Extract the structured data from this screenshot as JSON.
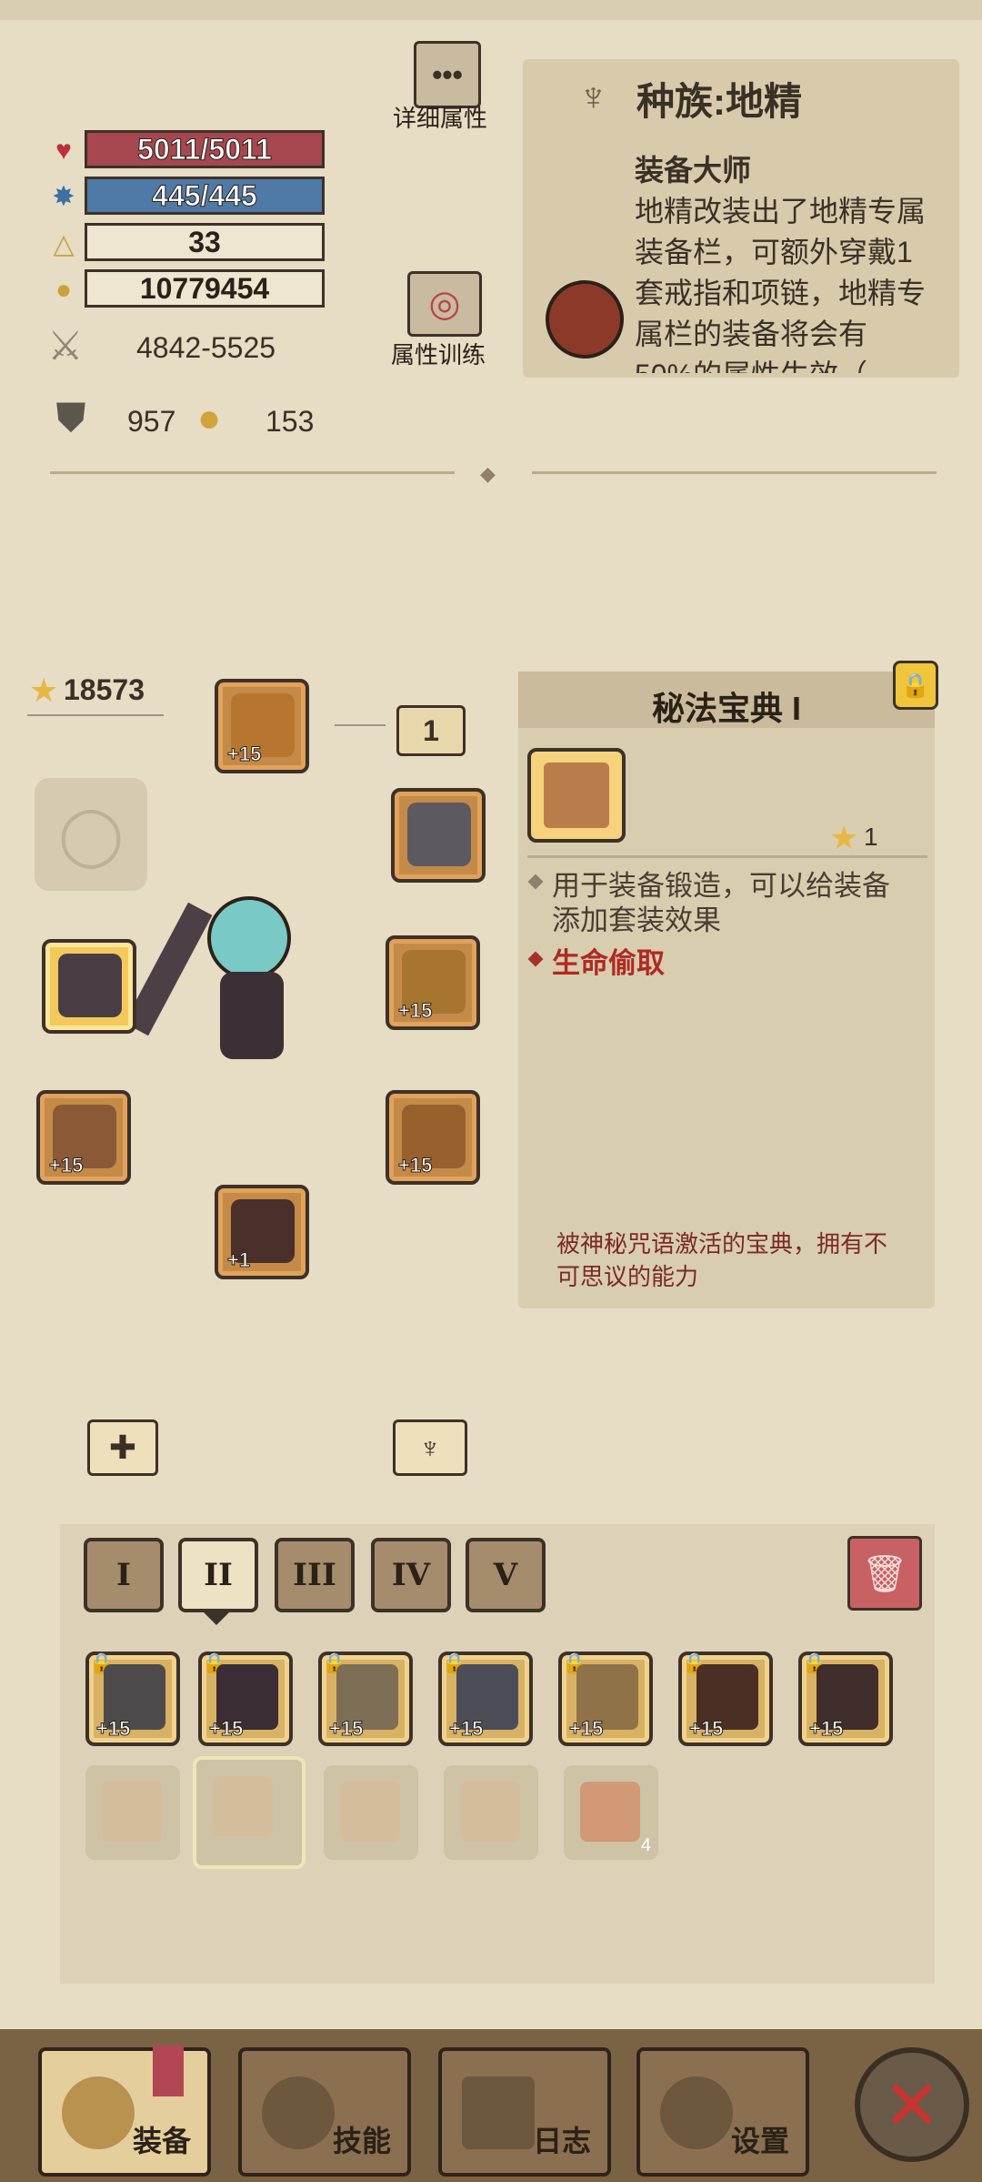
{
  "stats": {
    "hp": "5011/5011",
    "mp": "445/445",
    "level": "33",
    "gold": "10779454",
    "attack": "4842-5525",
    "armor": "957",
    "resist": "153"
  },
  "buttons": {
    "detail_attr": "详细属性",
    "attr_train": "属性训练"
  },
  "race": {
    "title": "种族:地精",
    "skill_name": "装备大师",
    "skill_desc": "地精改装出了地精专属装备栏，可额外穿戴1套戒指和项链，地精专属栏的装备将会有50%的属性生效（"
  },
  "equip": {
    "score": "18573",
    "slot_count": "1",
    "slots": [
      {
        "name": "hat",
        "level": "+15"
      },
      {
        "name": "necklace",
        "level": ""
      },
      {
        "name": "armor",
        "level": "+15"
      },
      {
        "name": "belt",
        "level": "+15"
      },
      {
        "name": "bracer",
        "level": "+15"
      },
      {
        "name": "boots",
        "level": "+1"
      },
      {
        "name": "weapon",
        "level": ""
      }
    ]
  },
  "detail": {
    "title": "秘法宝典 I",
    "stars": "1",
    "desc": "用于装备锻造，可以给装备添加套装效果",
    "effect": "生命偷取",
    "flavor": "被神秘咒语激活的宝典，拥有不可思议的能力",
    "effect_color": "#b02a22"
  },
  "set_tabs": [
    "I",
    "II",
    "III",
    "IV",
    "V"
  ],
  "inventory": {
    "row1": [
      "+15",
      "+15",
      "+15",
      "+15",
      "+15",
      "+15",
      "+15"
    ],
    "row2_count": "4"
  },
  "nav": {
    "equip": "装备",
    "skill": "技能",
    "log": "日志",
    "settings": "设置"
  }
}
